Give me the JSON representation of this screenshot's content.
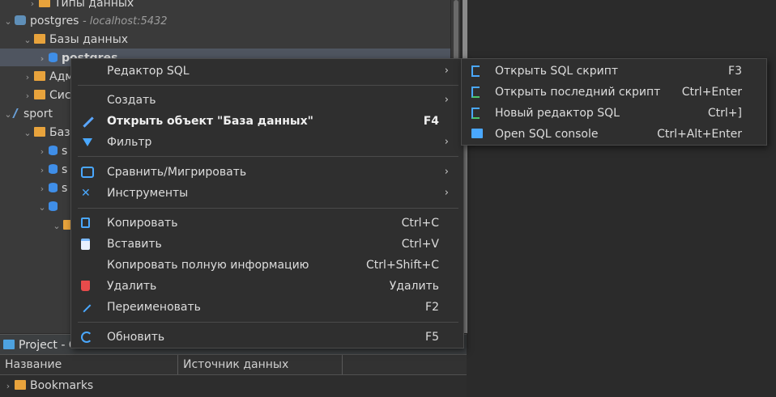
{
  "tree": {
    "rows": [
      {
        "label": "Типы данных",
        "icon": "folder-icon",
        "chev": "›"
      },
      {
        "label": "postgres",
        "suffix": "- localhost:5432",
        "icon": "postgres-connection-icon",
        "chev": "⌄"
      },
      {
        "label": "Базы данных",
        "icon": "folder-icon",
        "chev": "⌄"
      },
      {
        "label": "postgres",
        "icon": "database-icon",
        "chev": "›"
      },
      {
        "label": "Адм",
        "icon": "folder-icon",
        "chev": "›"
      },
      {
        "label": "Сис",
        "icon": "folder-icon",
        "chev": "›"
      },
      {
        "label": "sport",
        "icon": "sport-connection-icon",
        "chev": "⌄"
      },
      {
        "label": "Баз",
        "icon": "folder-icon",
        "chev": "⌄"
      },
      {
        "label": "s",
        "icon": "database-icon",
        "chev": "›"
      },
      {
        "label": "s",
        "icon": "database-icon",
        "chev": "›"
      },
      {
        "label": "s",
        "icon": "database-icon",
        "chev": "›"
      },
      {
        "label": "",
        "icon": "database-icon",
        "chev": "⌄"
      },
      {
        "label": "",
        "icon": "folder-icon",
        "chev": "⌄"
      }
    ]
  },
  "context_menu": {
    "items": [
      {
        "label": "Редактор SQL",
        "shortcut": "",
        "submenu": true,
        "icon": ""
      },
      {
        "label": "Создать",
        "shortcut": "",
        "submenu": true,
        "icon": ""
      },
      {
        "label": "Открыть объект \"База данных\"",
        "shortcut": "F4",
        "submenu": false,
        "icon": "pencil-icon",
        "bold": true
      },
      {
        "label": "Фильтр",
        "shortcut": "",
        "submenu": true,
        "icon": "filter-icon"
      },
      {
        "label": "Сравнить/Мигрировать",
        "shortcut": "",
        "submenu": true,
        "icon": "compare-icon"
      },
      {
        "label": "Инструменты",
        "shortcut": "",
        "submenu": true,
        "icon": "tools-icon"
      },
      {
        "label": "Копировать",
        "shortcut": "Ctrl+C",
        "submenu": false,
        "icon": "copy-icon"
      },
      {
        "label": "Вставить",
        "shortcut": "Ctrl+V",
        "submenu": false,
        "icon": "paste-icon"
      },
      {
        "label": "Копировать полную информацию",
        "shortcut": "Ctrl+Shift+C",
        "submenu": false,
        "icon": ""
      },
      {
        "label": "Удалить",
        "shortcut": "Удалить",
        "submenu": false,
        "icon": "delete-icon"
      },
      {
        "label": "Переименовать",
        "shortcut": "F2",
        "submenu": false,
        "icon": "rename-icon"
      },
      {
        "label": "Обновить",
        "shortcut": "F5",
        "submenu": false,
        "icon": "refresh-icon"
      }
    ],
    "arrow": "›"
  },
  "sql_submenu": {
    "items": [
      {
        "label": "Открыть SQL скрипт",
        "shortcut": "F3",
        "icon": "sql-script-icon"
      },
      {
        "label": "Открыть последний скрипт",
        "shortcut": "Ctrl+Enter",
        "icon": "recent-script-icon"
      },
      {
        "label": "Новый редактор SQL",
        "shortcut": "Ctrl+]",
        "icon": "new-editor-icon"
      },
      {
        "label": "Open SQL console",
        "shortcut": "Ctrl+Alt+Enter",
        "icon": "console-icon"
      }
    ]
  },
  "project_panel": {
    "tab_label": "Project - G",
    "columns": [
      "Название",
      "Источник данных"
    ],
    "rows": [
      {
        "label": "Bookmarks",
        "icon": "bookmarks-folder-icon",
        "chev": "›"
      }
    ]
  },
  "colors": {
    "menu_bg": "#2f2f2f",
    "accent": "#4aa8ff",
    "delete": "#e84b4b",
    "folder": "#e8a33c"
  }
}
